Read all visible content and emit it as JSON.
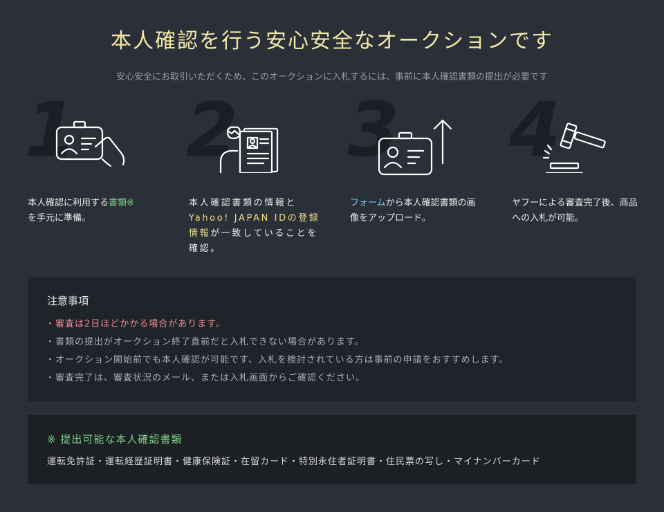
{
  "header": {
    "title": "本人確認を行う安心安全なオークションです",
    "subtitle": "安心安全にお取引いただくため、このオークションに入札するには、事前に本人確認書類の提出が必要です"
  },
  "steps": [
    {
      "number": "1",
      "icon": "id-card-hand-icon",
      "text_a": "本人確認に利用する",
      "text_hl": "書類※",
      "text_b": "を手元に準備。"
    },
    {
      "number": "2",
      "icon": "person-document-icon",
      "text_a": "本人確認書類の情報と",
      "text_hl": "Yahoo! JAPAN IDの登録情報",
      "text_b": "が一致していることを確認。"
    },
    {
      "number": "3",
      "icon": "id-card-upload-icon",
      "text_hl": "フォーム",
      "text_b": "から本人確認書類の画像をアップロード。"
    },
    {
      "number": "4",
      "icon": "gavel-icon",
      "text_a": "ヤフーによる審査完了後、商品への入札が可能。"
    }
  ],
  "notes": {
    "title": "注意事項",
    "items": [
      "・審査は2日ほどかかる場合があります。",
      "・書類の提出がオークション終了直前だと入札できない場合があります。",
      "・オークション開始前でも本人確認が可能です、入札を検討されている方は事前の申請をおすすめします。",
      "・審査完了は、審査状況のメール、または入札画面からご確認ください。"
    ]
  },
  "documents": {
    "title": "※ 提出可能な本人確認書類",
    "list": "運転免許証・運転経歴証明書・健康保険証・在留カード・特別永住者証明書・住民票の写し・マイナンバーカード"
  },
  "colors": {
    "background": "#2b2f38",
    "title": "#f2e9a8",
    "highlight_green": "#7fd18a",
    "highlight_yellow": "#eadf86",
    "highlight_blue": "#7fc4ea",
    "warning": "#f08a8f"
  }
}
